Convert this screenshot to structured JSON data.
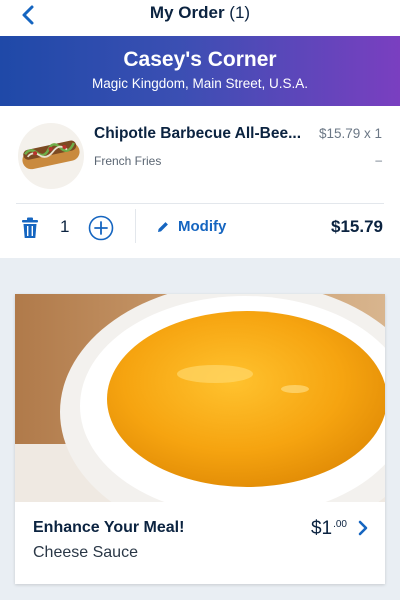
{
  "header": {
    "title": "My Order",
    "count": "(1)"
  },
  "restaurant": {
    "name": "Casey's Corner",
    "location": "Magic Kingdom, Main Street, U.S.A."
  },
  "order_item": {
    "name": "Chipotle Barbecue All-Bee...",
    "unit_price": "$15.79 x 1",
    "side": "French Fries",
    "side_price": "–",
    "quantity": "1",
    "modify_label": "Modify",
    "line_total": "$15.79"
  },
  "upsell": {
    "heading": "Enhance Your Meal!",
    "item": "Cheese Sauce",
    "price_dollars": "$1",
    "price_cents": ".00"
  },
  "colors": {
    "banner_start": "#1f49a8",
    "banner_end": "#7a3fc0",
    "accent": "#1565c0",
    "text_dark": "#0b2340"
  },
  "icons": {
    "back": "chevron-left-icon",
    "trash": "trash-icon",
    "plus": "plus-circle-icon",
    "modify": "pencil-icon",
    "forward": "chevron-right-icon"
  }
}
